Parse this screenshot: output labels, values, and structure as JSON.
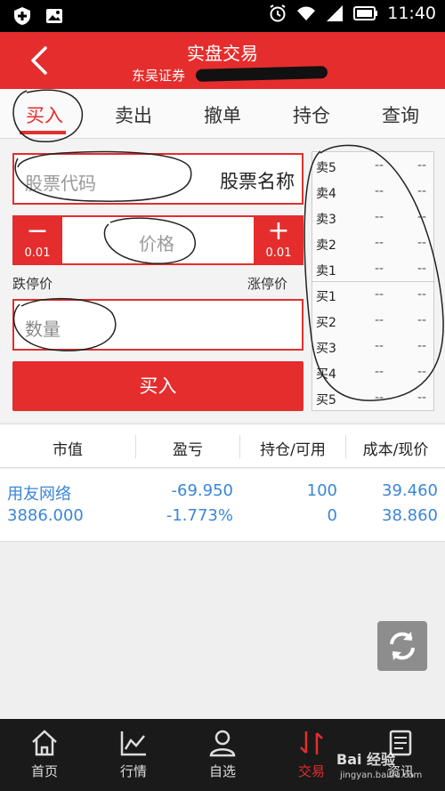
{
  "status_bar": {
    "time": "11:40"
  },
  "header": {
    "title": "实盘交易",
    "broker": "东吴证券"
  },
  "tabs": [
    {
      "label": "买入"
    },
    {
      "label": "卖出"
    },
    {
      "label": "撤单"
    },
    {
      "label": "持仓"
    },
    {
      "label": "查询"
    }
  ],
  "form": {
    "code_placeholder": "股票代码",
    "stock_name": "股票名称",
    "price_placeholder": "价格",
    "price_step_minus": "0.01",
    "price_step_plus": "0.01",
    "limit_down_label": "跌停价",
    "limit_up_label": "涨停价",
    "qty_placeholder": "数量",
    "submit_label": "买入"
  },
  "orderbook": [
    {
      "label": "卖5",
      "price": "--",
      "vol": "--"
    },
    {
      "label": "卖4",
      "price": "--",
      "vol": "--"
    },
    {
      "label": "卖3",
      "price": "--",
      "vol": "--"
    },
    {
      "label": "卖2",
      "price": "--",
      "vol": "--"
    },
    {
      "label": "卖1",
      "price": "--",
      "vol": "--"
    },
    {
      "label": "买1",
      "price": "--",
      "vol": "--"
    },
    {
      "label": "买2",
      "price": "--",
      "vol": "--"
    },
    {
      "label": "买3",
      "price": "--",
      "vol": "--"
    },
    {
      "label": "买4",
      "price": "--",
      "vol": "--"
    },
    {
      "label": "买5",
      "price": "--",
      "vol": "--"
    }
  ],
  "positions": {
    "columns": [
      "市值",
      "盈亏",
      "持仓/可用",
      "成本/现价"
    ],
    "rows": [
      {
        "name": "用友网络",
        "market_value": "3886.000",
        "pnl": "-69.950",
        "pnl_pct": "-1.773%",
        "holding": "100",
        "available": "0",
        "cost": "39.460",
        "price": "38.860"
      }
    ]
  },
  "bottom_nav": [
    {
      "label": "首页",
      "icon": "home-icon"
    },
    {
      "label": "行情",
      "icon": "chart-icon"
    },
    {
      "label": "自选",
      "icon": "user-icon"
    },
    {
      "label": "交易",
      "icon": "trade-icon"
    },
    {
      "label": "资讯",
      "icon": "news-icon"
    }
  ],
  "watermark": {
    "text": "Bai 经验",
    "sub": "jingyan.baidu.com"
  },
  "colors": {
    "brand": "#e52d2d",
    "link": "#3a86d8",
    "nav_bg": "#1a1a1a"
  }
}
